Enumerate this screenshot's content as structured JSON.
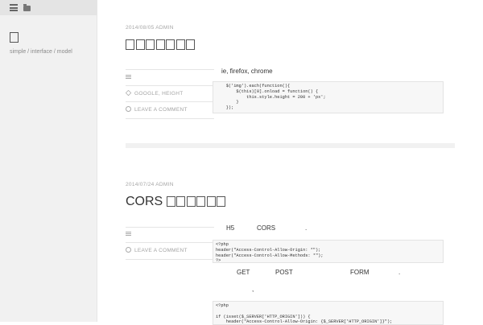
{
  "sidebar": {
    "site_title": "",
    "site_description": "simple / interface / model",
    "icons": [
      "menu-icon",
      "folder-icon"
    ]
  },
  "posts": [
    {
      "meta": "2014/08/05 ADMIN",
      "title": "",
      "tags_label": "GOOGLE, HEIGHT",
      "comment_label": "LEAVE A COMMENT",
      "intro": "ie, firefox, chrome",
      "code_lines": [
        "    $('img').each(function(){",
        "        $(this)[0].onload = function() {",
        "            this.style.height = 200 + 'px';",
        "        }",
        "    });"
      ]
    },
    {
      "meta": "2014/07/24 ADMIN",
      "title": "CORS",
      "comment_label": "LEAVE A COMMENT",
      "intro_parts": [
        "H5",
        "CORS",
        "."
      ],
      "code_lines": [
        "<?php",
        "header(\"Access-Control-Allow-Origin: *\");",
        "header(\"Access-Control-Allow-Methods: *\");",
        "?>"
      ],
      "line2_parts": [
        "GET",
        "POST",
        "FORM",
        "."
      ],
      "line3": ",",
      "code2_lines": [
        "<?php",
        "",
        "if (isset($_SERVER['HTTP_ORIGIN'])) {",
        "    header(\"Access-Control-Allow-Origin: {$_SERVER['HTTP_ORIGIN']}\");"
      ]
    }
  ],
  "colors": {
    "sidebar_bg": "#f1f1f1",
    "accent_text": "#333333"
  }
}
